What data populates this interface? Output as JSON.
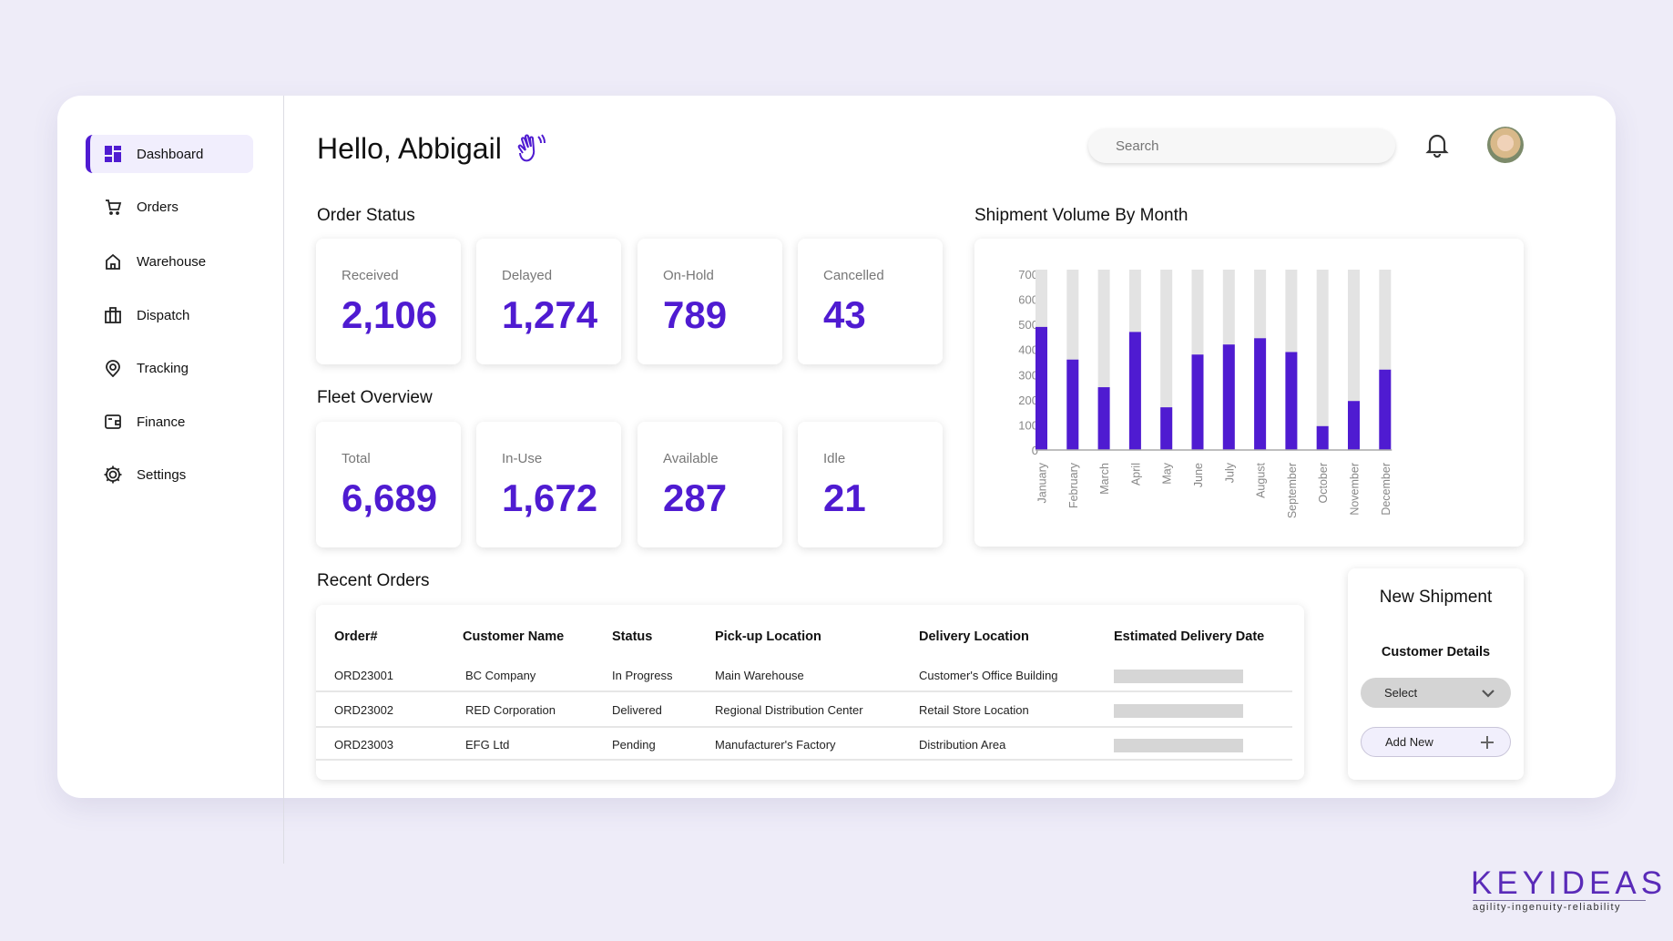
{
  "sidebar": {
    "items": [
      {
        "label": "Dashboard",
        "icon": "dashboard-icon",
        "active": true
      },
      {
        "label": "Orders",
        "icon": "cart-icon"
      },
      {
        "label": "Warehouse",
        "icon": "home-icon"
      },
      {
        "label": "Dispatch",
        "icon": "briefcase-icon"
      },
      {
        "label": "Tracking",
        "icon": "location-pin-icon"
      },
      {
        "label": "Finance",
        "icon": "wallet-icon"
      },
      {
        "label": "Settings",
        "icon": "gear-icon"
      }
    ]
  },
  "header": {
    "greeting": "Hello, Abbigail",
    "search_placeholder": "Search"
  },
  "order_status": {
    "title": "Order Status",
    "cards": [
      {
        "label": "Received",
        "value": "2,106"
      },
      {
        "label": "Delayed",
        "value": "1,274"
      },
      {
        "label": "On-Hold",
        "value": "789"
      },
      {
        "label": "Cancelled",
        "value": "43"
      }
    ]
  },
  "fleet": {
    "title": "Fleet Overview",
    "cards": [
      {
        "label": "Total",
        "value": "6,689"
      },
      {
        "label": "In-Use",
        "value": "1,672"
      },
      {
        "label": "Available",
        "value": "287"
      },
      {
        "label": "Idle",
        "value": "21"
      }
    ]
  },
  "chart_data": {
    "type": "bar",
    "title": "Shipment Volume By Month",
    "categories": [
      "January",
      "February",
      "March",
      "April",
      "May",
      "June",
      "July",
      "August",
      "September",
      "October",
      "November",
      "December"
    ],
    "values": [
      490,
      360,
      250,
      470,
      170,
      380,
      420,
      445,
      390,
      95,
      195,
      320
    ],
    "yticks": [
      0,
      100,
      200,
      300,
      400,
      500,
      600,
      700
    ],
    "ylim": [
      0,
      700
    ],
    "grid": false,
    "colors": {
      "bar": "#4f1bd1",
      "track": "#e3e3e3"
    }
  },
  "recent_orders": {
    "title": "Recent Orders",
    "columns": [
      "Order#",
      "Customer Name",
      "Status",
      "Pick-up Location",
      "Delivery Location",
      "Estimated Delivery Date"
    ],
    "rows": [
      [
        "ORD23001",
        "BC Company",
        "In Progress",
        "Main Warehouse",
        "Customer's Office Building"
      ],
      [
        "ORD23002",
        "RED Corporation",
        "Delivered",
        "Regional Distribution Center",
        "Retail Store Location"
      ],
      [
        "ORD23003",
        "EFG Ltd",
        "Pending",
        "Manufacturer's Factory",
        "Distribution Area"
      ]
    ]
  },
  "new_shipment": {
    "title": "New Shipment",
    "subtitle": "Customer Details",
    "select_label": "Select",
    "add_label": "Add New"
  },
  "logo": {
    "name": "KEYIDEAS",
    "tagline": "agility-ingenuity-reliability"
  },
  "accent": "#4f1bd1"
}
